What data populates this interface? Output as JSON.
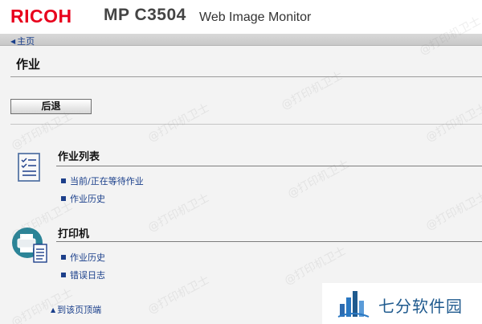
{
  "header": {
    "brand": "RICOH",
    "model": "MP C3504",
    "product": "Web Image Monitor"
  },
  "nav": {
    "home_link": "主页"
  },
  "page": {
    "title": "作业"
  },
  "toolbar": {
    "back_label": "后退"
  },
  "sections": [
    {
      "title": "作业列表",
      "icon": "job-list-icon",
      "items": [
        "当前/正在等待作业",
        "作业历史"
      ]
    },
    {
      "title": "打印机",
      "icon": "printer-icon",
      "items": [
        "作业历史",
        "错误日志"
      ]
    }
  ],
  "footer": {
    "to_top": "到该页顶端"
  },
  "watermark": {
    "text": "@打印机卫士"
  },
  "ad": {
    "text": "七分软件园"
  },
  "colors": {
    "brand_red": "#e8001c",
    "link_blue": "#1a3f8b",
    "background": "#f3f3f3"
  }
}
